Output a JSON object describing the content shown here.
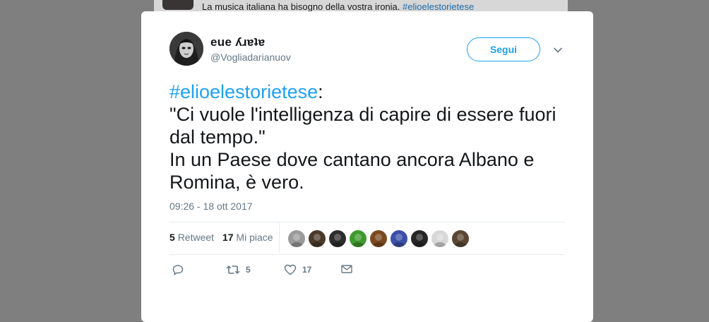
{
  "background": {
    "text": "La musica italiana ha bisogno della vostra ironia.",
    "hashtag": "#elioelestorietese"
  },
  "author": {
    "display_name": "ɐʇɐɹʎ ǝnǝ",
    "display_name_rendered": "eue ʎɹɐʇɐ",
    "handle": "@Vogliadarianuov"
  },
  "follow_button": {
    "label": "Segui"
  },
  "tweet": {
    "hashtag": "#elioelestorietese",
    "hashtag_suffix": ":",
    "line1": "\"Ci vuole l'intelligenza di capire di essere fuori dal tempo.\"",
    "line2": "In un Paese dove cantano ancora Albano e Romina, è vero."
  },
  "timestamp": "09:26 - 18 ott 2017",
  "stats": {
    "retweets_count": "5",
    "retweets_label": "Retweet",
    "likes_count": "17",
    "likes_label": "Mi piace"
  },
  "likers": [
    {
      "name": "liker-1",
      "color": "#9a9a9a"
    },
    {
      "name": "liker-2",
      "color": "#4a3a2a"
    },
    {
      "name": "liker-3",
      "color": "#2d2d2d"
    },
    {
      "name": "liker-4",
      "color": "#3f9a2e"
    },
    {
      "name": "liker-5",
      "color": "#7a4a1e"
    },
    {
      "name": "liker-6",
      "color": "#3c4fa8"
    },
    {
      "name": "liker-7",
      "color": "#262626"
    },
    {
      "name": "liker-8",
      "color": "#d8d8d8"
    },
    {
      "name": "liker-9",
      "color": "#5a4632"
    }
  ],
  "actions": {
    "reply_icon": "reply-icon",
    "retweet_icon": "retweet-icon",
    "retweet_count": "5",
    "like_icon": "heart-icon",
    "like_count": "17",
    "dm_icon": "envelope-icon"
  },
  "colors": {
    "accent": "#1da1f2",
    "overlay": "#7f7f7f",
    "secondary_text": "#657786"
  }
}
